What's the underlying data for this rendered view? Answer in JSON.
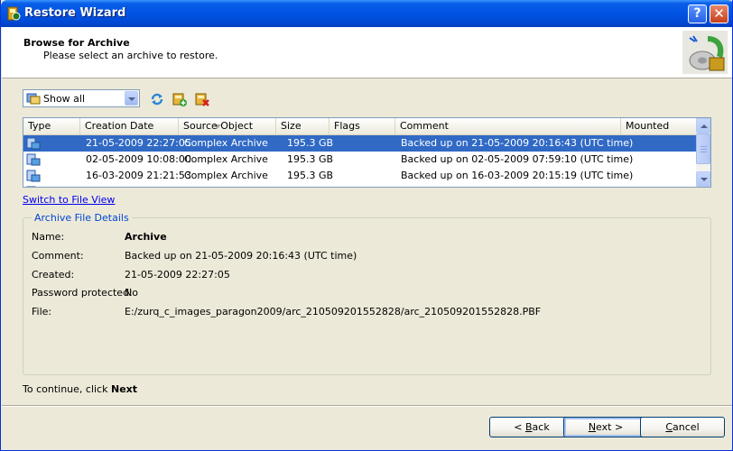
{
  "window": {
    "title": "Restore Wizard",
    "help_glyph": "?",
    "close_glyph": "✕"
  },
  "header": {
    "title": "Browse for Archive",
    "subtitle": "Please select an archive to restore."
  },
  "toolbar": {
    "filter_value": "Show all",
    "tools": [
      "refresh-icon",
      "add-archive-icon",
      "delete-archive-icon"
    ]
  },
  "table": {
    "columns": [
      "Type",
      "Creation Date",
      "Source Object",
      "Size",
      "Flags",
      "Comment",
      "Mounted"
    ],
    "rows": [
      {
        "date": "21-05-2009 22:27:05",
        "source": "Complex Archive",
        "size": "195.3 GB",
        "flags": "",
        "comment": "Backed up on 21-05-2009 20:16:43 (UTC time)",
        "mounted": ""
      },
      {
        "date": "02-05-2009 10:08:00",
        "source": "Complex Archive",
        "size": "195.3 GB",
        "flags": "",
        "comment": "Backed up on 02-05-2009 07:59:10 (UTC time)",
        "mounted": ""
      },
      {
        "date": "16-03-2009 21:21:53",
        "source": "Complex Archive",
        "size": "195.3 GB",
        "flags": "",
        "comment": "Backed up on 16-03-2009 20:15:19 (UTC time)",
        "mounted": ""
      }
    ],
    "selected_index": 0
  },
  "switch_link": "Switch to File View",
  "details": {
    "title": "Archive File Details",
    "name_label": "Name:",
    "name_value": "Archive",
    "comment_label": "Comment:",
    "comment_value": "Backed up on 21-05-2009 20:16:43 (UTC time)",
    "created_label": "Created:",
    "created_value": "21-05-2009 22:27:05",
    "password_label": "Password protected:",
    "password_value": "No",
    "file_label": "File:",
    "file_value": "E:/zurq_c_images_paragon2009/arc_210509201552828/arc_210509201552828.PBF"
  },
  "footer": {
    "continue_prefix": "To continue, click",
    "continue_action": "Next"
  },
  "buttons": {
    "back_prefix": "< ",
    "back_key": "B",
    "back_rest": "ack",
    "next_key": "N",
    "next_rest": "ext >",
    "cancel_key": "C",
    "cancel_rest": "ancel"
  },
  "colors": {
    "title_bar": "#0054e3",
    "selection": "#316ac5",
    "link": "#0000ee",
    "group_title": "#0046d5",
    "dialog_bg": "#ece9d8"
  }
}
